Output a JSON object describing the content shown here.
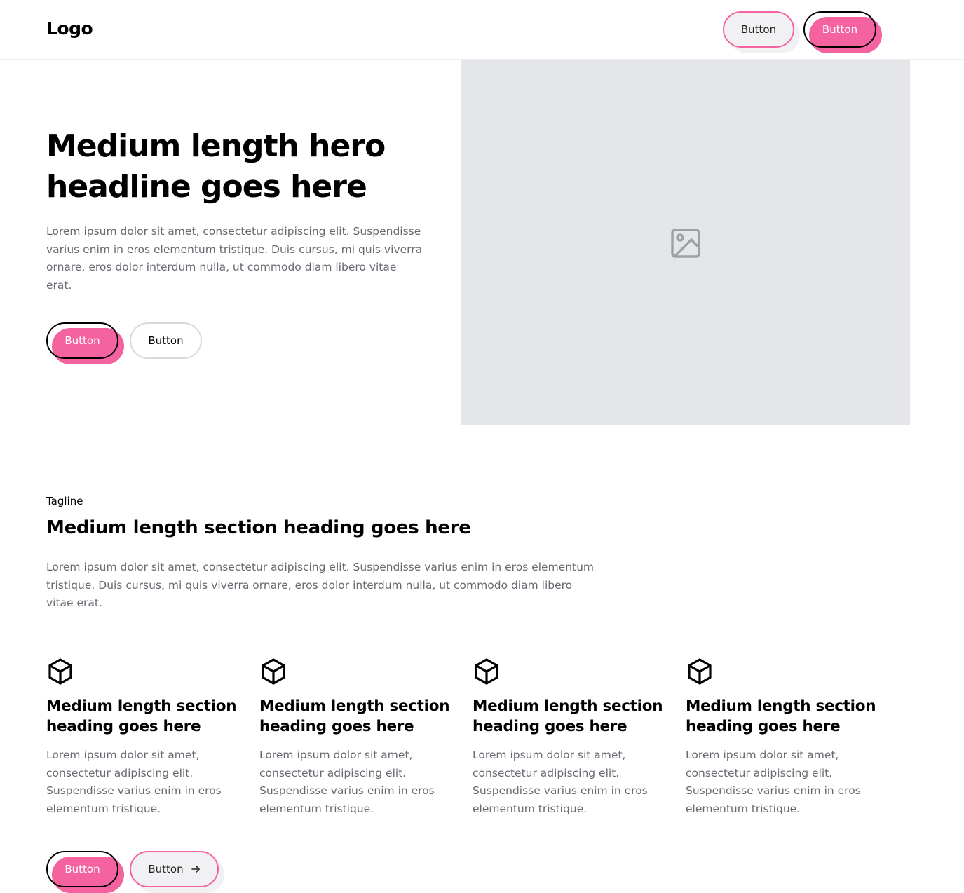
{
  "navbar": {
    "logo": "Logo",
    "secondary_button": "Button",
    "primary_button": "Button"
  },
  "hero": {
    "headline": "Medium length hero headline goes here",
    "text": "Lorem ipsum dolor sit amet, consectetur adipiscing elit. Suspendisse varius enim in eros elementum tristique. Duis cursus, mi quis viverra ornare, eros dolor interdum nulla, ut commodo diam libero vitae erat.",
    "primary_button": "Button",
    "secondary_button": "Button",
    "image_icon": "image-icon"
  },
  "section": {
    "tagline": "Tagline",
    "heading": "Medium length section heading goes here",
    "text": "Lorem ipsum dolor sit amet, consectetur adipiscing elit. Suspendisse varius enim in eros elementum tristique. Duis cursus, mi quis viverra ornare, eros dolor interdum nulla, ut commodo diam libero vitae erat.",
    "features": [
      {
        "icon": "cube-icon",
        "heading": "Medium length section heading goes here",
        "text": "Lorem ipsum dolor sit amet, consectetur adipiscing elit. Suspendisse varius enim in eros elementum tristique."
      },
      {
        "icon": "cube-icon",
        "heading": "Medium length section heading goes here",
        "text": "Lorem ipsum dolor sit amet, consectetur adipiscing elit. Suspendisse varius enim in eros elementum tristique."
      },
      {
        "icon": "cube-icon",
        "heading": "Medium length section heading goes here",
        "text": "Lorem ipsum dolor sit amet, consectetur adipiscing elit. Suspendisse varius enim in eros elementum tristique."
      },
      {
        "icon": "cube-icon",
        "heading": "Medium length section heading goes here",
        "text": "Lorem ipsum dolor sit amet, consectetur adipiscing elit. Suspendisse varius enim in eros elementum tristique."
      }
    ],
    "primary_button": "Button",
    "secondary_button": "Button",
    "secondary_button_icon": "arrow-right-icon"
  },
  "colors": {
    "accent": "#f4639f",
    "image_placeholder": "#e5e6ea",
    "body_text": "#666a70"
  }
}
